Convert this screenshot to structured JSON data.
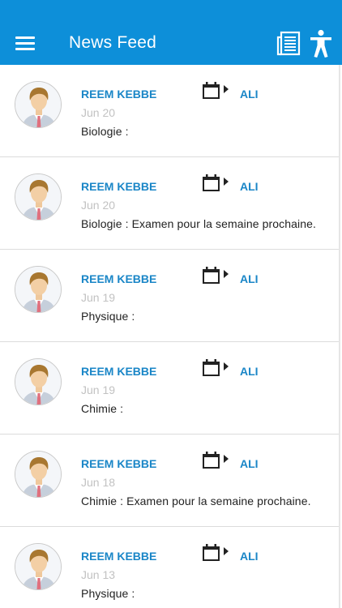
{
  "app_bar": {
    "title": "News Feed",
    "background_color": "#0d8fd9",
    "menu_icon": "hamburger-menu-icon",
    "feed_icon": "newspaper-icon",
    "accessibility_icon": "accessibility-person-icon"
  },
  "posts": [
    {
      "author": "REEM KEBBE",
      "recipient": "ALI",
      "date": "Jun 20",
      "message": "Biologie :"
    },
    {
      "author": "REEM KEBBE",
      "recipient": "ALI",
      "date": "Jun 20",
      "message": "Biologie : Examen pour la semaine prochaine."
    },
    {
      "author": "REEM KEBBE",
      "recipient": "ALI",
      "date": "Jun 19",
      "message": "Physique :"
    },
    {
      "author": "REEM KEBBE",
      "recipient": "ALI",
      "date": "Jun 19",
      "message": "Chimie :"
    },
    {
      "author": "REEM KEBBE",
      "recipient": "ALI",
      "date": "Jun 18",
      "message": "Chimie : Examen pour la semaine prochaine."
    },
    {
      "author": "REEM KEBBE",
      "recipient": "ALI",
      "date": "Jun 13",
      "message": "Physique :"
    }
  ],
  "colors": {
    "accent": "#1a86c7",
    "date_text": "#c2c2c2",
    "divider": "#dcdcdc"
  }
}
